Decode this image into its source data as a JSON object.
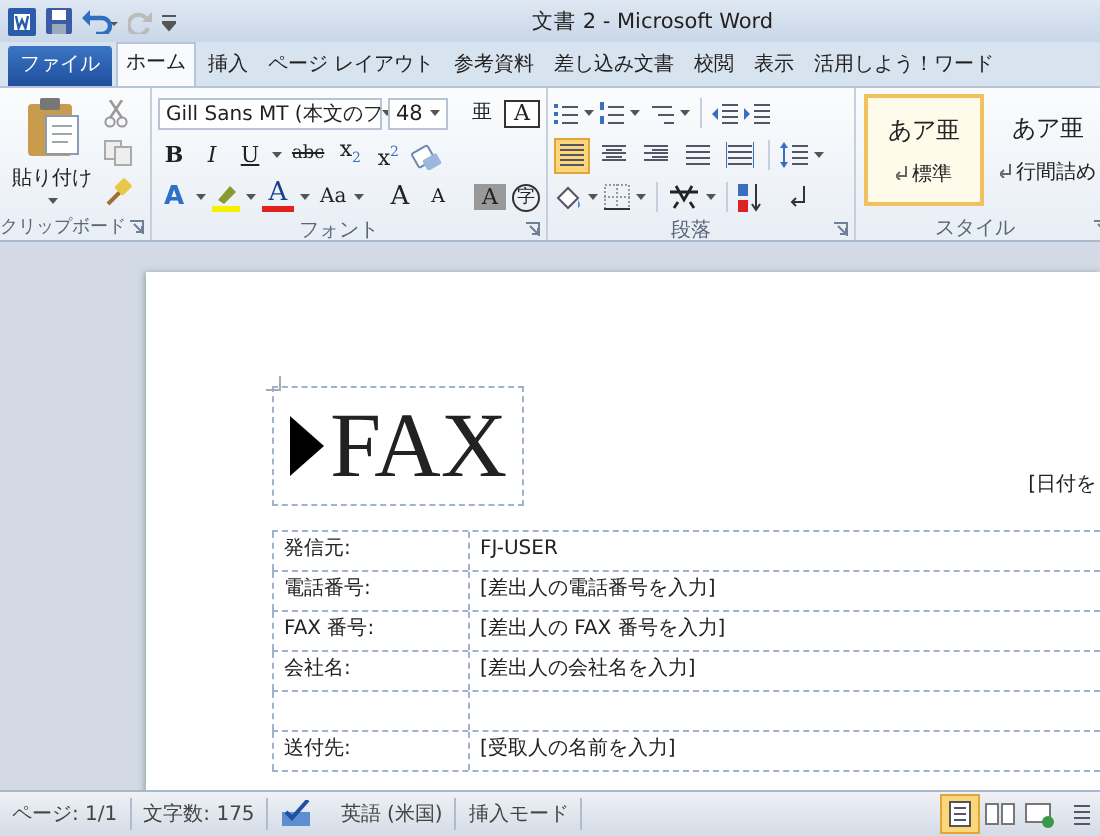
{
  "window": {
    "title": "文書 2 - Microsoft Word"
  },
  "tabs": [
    {
      "label": "ファイル",
      "kind": "file",
      "selected": false
    },
    {
      "label": "ホーム",
      "kind": "tab",
      "selected": true
    },
    {
      "label": "挿入",
      "kind": "tab",
      "selected": false
    },
    {
      "label": "ページ レイアウト",
      "kind": "tab",
      "selected": false
    },
    {
      "label": "参考資料",
      "kind": "tab",
      "selected": false
    },
    {
      "label": "差し込み文書",
      "kind": "tab",
      "selected": false
    },
    {
      "label": "校閲",
      "kind": "tab",
      "selected": false
    },
    {
      "label": "表示",
      "kind": "tab",
      "selected": false
    },
    {
      "label": "活用しよう！ワード",
      "kind": "tab",
      "selected": false
    }
  ],
  "ribbon": {
    "clipboard": {
      "paste_label": "貼り付け",
      "group_label": "クリップボード"
    },
    "font": {
      "font_name": "Gill Sans MT (本文のフ",
      "font_size": "48",
      "group_label": "フォント",
      "name_buttons": [
        {
          "glyph": "亜",
          "kind": "ruby"
        },
        {
          "glyph": "A",
          "kind": "border"
        }
      ],
      "format_buttons": [
        {
          "glyph": "B",
          "kind": "bold"
        },
        {
          "glyph": "I",
          "kind": "italic"
        },
        {
          "glyph": "U",
          "kind": "underline"
        },
        {
          "glyph": "abc",
          "kind": "strike"
        },
        {
          "glyph": "x$_{2}$",
          "kind": "script"
        },
        {
          "glyph": "x$^{2}$",
          "kind": "script"
        },
        {
          "kind": "eraser"
        }
      ],
      "effect_buttons": [
        {
          "glyph": "A",
          "kind": "effect"
        },
        {
          "kind": "highlight"
        },
        {
          "glyph": "A",
          "kind": "color"
        },
        {
          "glyph": "Aa",
          "kind": "case"
        },
        {
          "glyph": "A",
          "kind": "grow"
        },
        {
          "glyph": "A",
          "kind": "shrink"
        },
        {
          "glyph": "A",
          "kind": "shade"
        },
        {
          "glyph": "字",
          "kind": "enclose"
        }
      ]
    },
    "paragraph": {
      "group_label": "段落",
      "alignments": [
        {
          "selected": true
        },
        {
          "selected": false
        },
        {
          "selected": false
        },
        {
          "selected": false
        },
        {
          "selected": false
        }
      ]
    },
    "styles": {
      "group_label": "スタイル",
      "items": [
        {
          "sample": "あア亜",
          "label": "標準",
          "selected": true
        },
        {
          "sample": "あア亜",
          "label": "行間詰め",
          "selected": false
        }
      ]
    }
  },
  "document": {
    "title": "FAX",
    "date_placeholder": "[日付を",
    "rows": [
      {
        "label": "発信元:",
        "value": "FJ-USER"
      },
      {
        "label": "電話番号:",
        "value": "[差出人の電話番号を入力]"
      },
      {
        "label": "FAX 番号:",
        "value": "[差出人の FAX 番号を入力]"
      },
      {
        "label": "会社名:",
        "value": "[差出人の会社名を入力]"
      },
      {
        "label": "",
        "value": ""
      },
      {
        "label": "送付先:",
        "value": "[受取人の名前を入力]"
      }
    ]
  },
  "status_bar": {
    "page": "ページ: 1/1",
    "word_count": "文字数: 175",
    "language": "英語 (米国)",
    "mode": "挿入モード",
    "views": [
      {
        "selected": true
      },
      {
        "selected": false
      },
      {
        "selected": false
      },
      {
        "selected": false
      }
    ]
  }
}
